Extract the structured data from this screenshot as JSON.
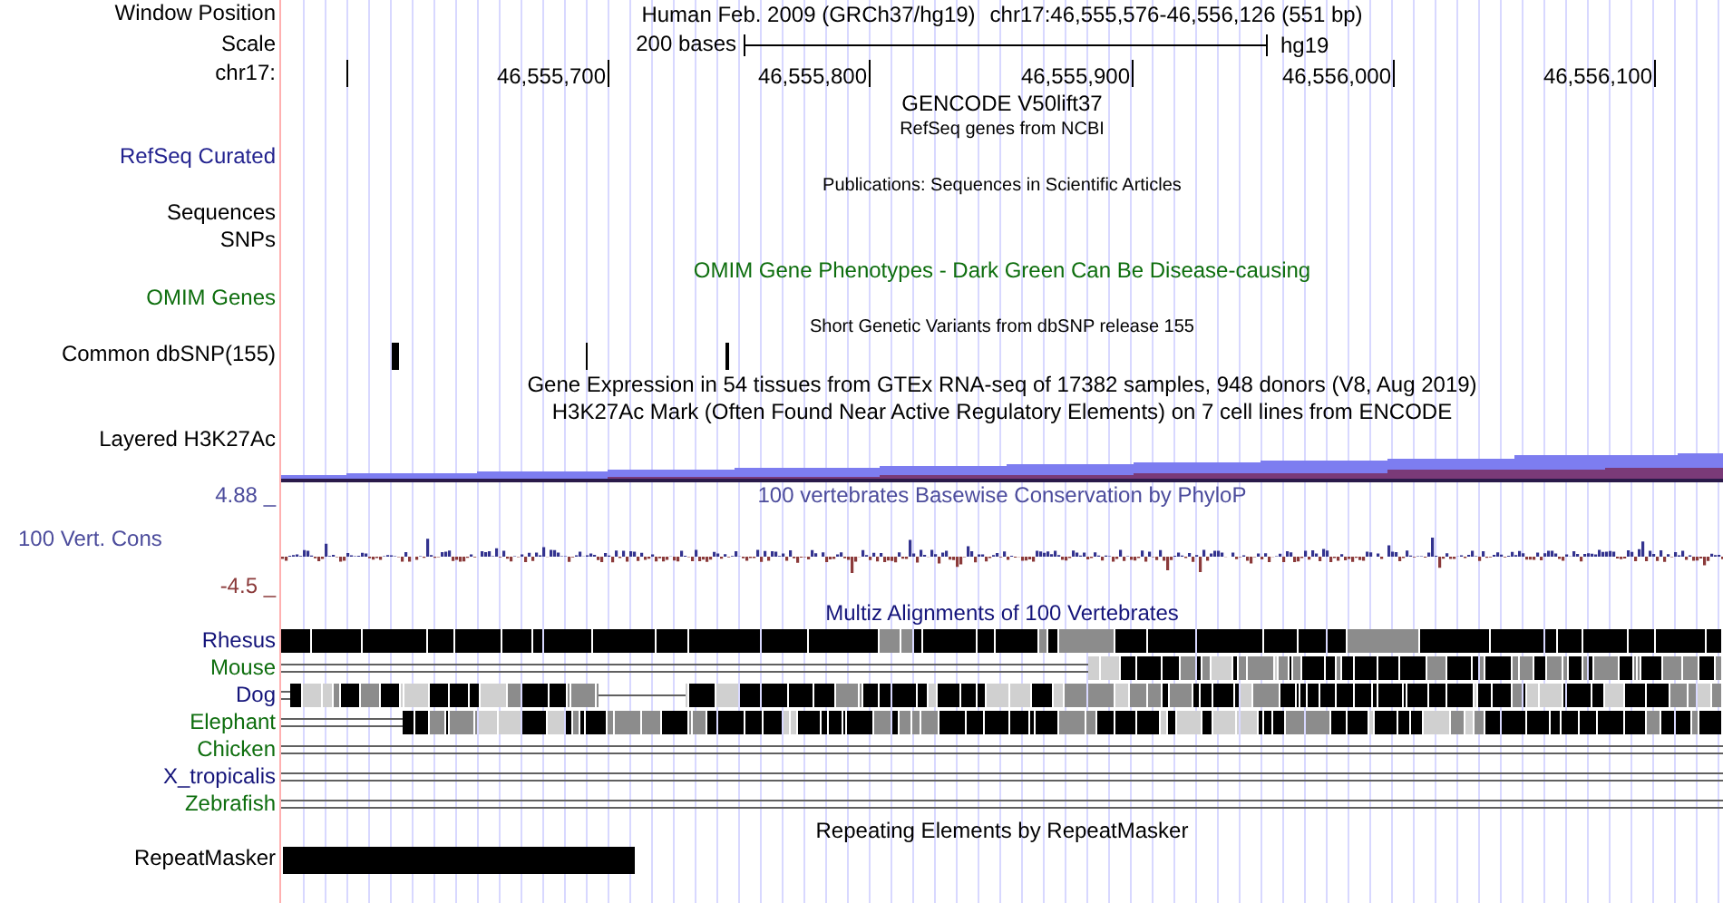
{
  "header": {
    "label": "Window Position",
    "assembly": "Human Feb. 2009 (GRCh37/hg19)",
    "position": "chr17:46,555,576-46,556,126 (551 bp)"
  },
  "scale": {
    "label": "Scale",
    "length": "200 bases",
    "assembly": "hg19"
  },
  "ruler": {
    "label": "chr17:",
    "ticks": [
      "46,555,700",
      "46,555,800",
      "46,555,900",
      "46,556,000",
      "46,556,100"
    ]
  },
  "tracks": [
    {
      "kind": "none",
      "title": "GENCODE V50lift37",
      "small_title": false,
      "color": "#000000"
    },
    {
      "kind": "blank",
      "title": "RefSeq genes from NCBI",
      "small_title": true,
      "color": "#000000",
      "labels": [
        {
          "text": "RefSeq Curated",
          "color": "#23238f"
        }
      ]
    },
    {
      "kind": "blank",
      "title": "Publications: Sequences in Scientific Articles",
      "small_title": true,
      "color": "#000000",
      "labels": [
        {
          "text": "Sequences",
          "color": "#000000"
        },
        {
          "text": "SNPs",
          "color": "#000000"
        }
      ]
    },
    {
      "kind": "blank",
      "title": "OMIM Gene Phenotypes - Dark Green Can Be Disease-causing",
      "small_title": false,
      "color": "#0e6e0e",
      "labels": [
        {
          "text": "OMIM Genes",
          "color": "#0e6e0e"
        }
      ]
    },
    {
      "kind": "snps",
      "title": "Short Genetic Variants from dbSNP release 155",
      "small_title": true,
      "color": "#000000",
      "labels": [
        {
          "text": "Common dbSNP(155)",
          "color": "#000000"
        }
      ]
    },
    {
      "kind": "none",
      "title": "Gene Expression in 54 tissues from GTEx RNA-seq of 17382 samples, 948 donors (V8, Aug 2019)",
      "small_title": false,
      "color": "#000000"
    },
    {
      "kind": "layered",
      "title": "H3K27Ac Mark (Often Found Near Active Regulatory Elements) on 7 cell lines from ENCODE",
      "small_title": false,
      "color": "#000000",
      "labels": [
        {
          "text": "Layered H3K27Ac",
          "color": "#000000"
        }
      ]
    },
    {
      "kind": "wiggle",
      "title": "100 vertebrates Basewise Conservation by PhyloP",
      "small_title": false,
      "color": "#4c4c9c",
      "max_label": {
        "text": "4.88 _",
        "color": "#4c4c9c"
      },
      "labels": [
        {
          "text": "100 Vert. Cons",
          "color": "#4c4c9c"
        }
      ],
      "min_label": {
        "text": "-4.5 _",
        "color": "#8b3a3a"
      }
    },
    {
      "kind": "multiz",
      "title": "Multiz Alignments of 100 Vertebrates",
      "small_title": false,
      "color": "#14147a",
      "species": [
        {
          "name": "Rhesus",
          "color": "#14147a",
          "kind": "full"
        },
        {
          "name": "Mouse",
          "color": "#0e6e0e",
          "kind": "partial"
        },
        {
          "name": "Dog",
          "color": "#14147a",
          "kind": "gapped"
        },
        {
          "name": "Elephant",
          "color": "#0e6e0e",
          "kind": "partial"
        },
        {
          "name": "Chicken",
          "color": "#0e6e0e",
          "kind": "none"
        },
        {
          "name": "X_tropicalis",
          "color": "#14147a",
          "kind": "none"
        },
        {
          "name": "Zebrafish",
          "color": "#0e6e0e",
          "kind": "none"
        }
      ]
    },
    {
      "kind": "repeat",
      "title": "Repeating Elements by RepeatMasker",
      "small_title": false,
      "color": "#000000",
      "labels": [
        {
          "text": "RepeatMasker",
          "color": "#000000"
        }
      ]
    }
  ]
}
